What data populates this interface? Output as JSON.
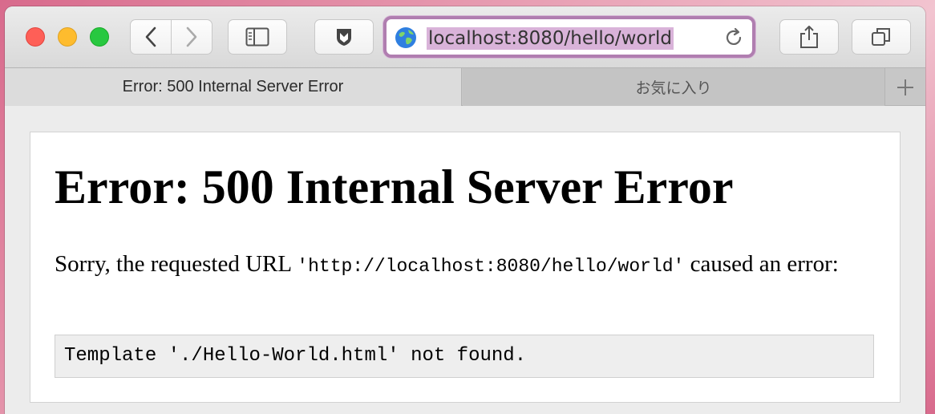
{
  "toolbar": {
    "url": "localhost:8080/hello/world",
    "icons": {
      "back": "chevron-left-icon",
      "forward": "chevron-right-icon",
      "sidebar": "sidebar-icon",
      "extension": "shield-icon",
      "reload": "reload-icon",
      "share": "share-icon",
      "tabs": "tab-overview-icon"
    }
  },
  "tabs": [
    {
      "label": "Error: 500 Internal Server Error",
      "active": true
    },
    {
      "label": "お気に入り",
      "active": false
    }
  ],
  "page": {
    "title": "Error: 500 Internal Server Error",
    "message_before": "Sorry, the requested URL ",
    "message_url": "'http://localhost:8080/hello/world'",
    "message_after": " caused an error:",
    "detail": "Template './Hello-World.html' not found."
  },
  "colors": {
    "close": "#fe5f57",
    "minimize": "#febc2e",
    "maximize": "#28c840",
    "url_focus_ring": "#b07eb0",
    "url_selection": "#d9b3d9"
  }
}
